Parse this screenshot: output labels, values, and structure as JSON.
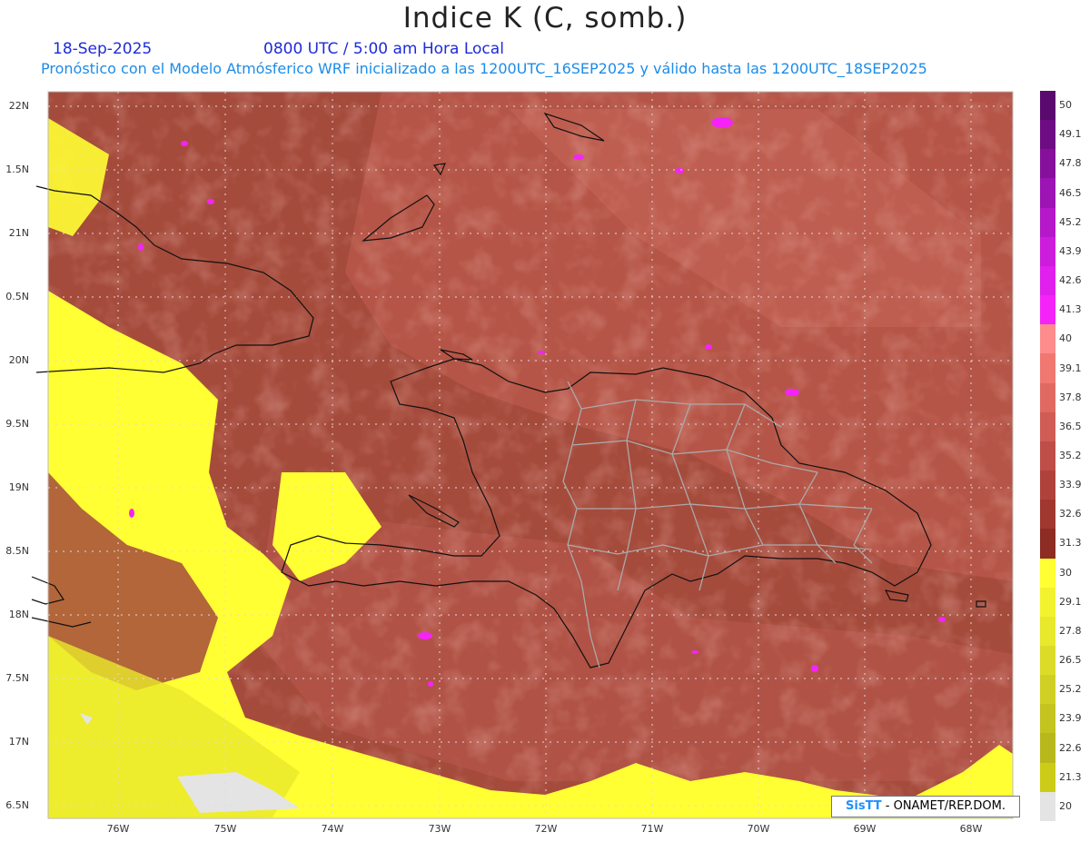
{
  "title": "Indice K (C, somb.)",
  "date": "18-Sep-2025",
  "time": "0800 UTC / 5:00 am Hora Local",
  "description": "Pronóstico con el Modelo Atmósferico WRF inicializado a las 1200UTC_16SEP2025 y válido hasta las  1200UTC_18SEP2025",
  "lat_labels": [
    "22N",
    "1.5N",
    "21N",
    "0.5N",
    "20N",
    "9.5N",
    "19N",
    "8.5N",
    "18N",
    "7.5N",
    "17N",
    "6.5N"
  ],
  "lon_labels": [
    "76W",
    "75W",
    "74W",
    "73W",
    "72W",
    "71W",
    "70W",
    "69W",
    "68W"
  ],
  "colorbar": {
    "labels": [
      "50",
      "49.1",
      "47.8",
      "46.5",
      "45.2",
      "43.9",
      "42.6",
      "41.3",
      "40",
      "39.1",
      "37.8",
      "36.5",
      "35.2",
      "33.9",
      "32.6",
      "31.3",
      "30",
      "29.1",
      "27.8",
      "26.5",
      "25.2",
      "23.9",
      "22.6",
      "21.3",
      "20"
    ],
    "colors": [
      "#5a0a6e",
      "#6e0c84",
      "#86109c",
      "#9c14b4",
      "#b418c8",
      "#cc1cdc",
      "#e020ec",
      "#f424f8",
      "#ff8c8c",
      "#f07870",
      "#e06a62",
      "#d05c56",
      "#c04e48",
      "#b0423c",
      "#a03830",
      "#8c2c22",
      "#ffff33",
      "#f2f22e",
      "#e8e82c",
      "#dcdc28",
      "#d0d024",
      "#c4c420",
      "#b8b81c",
      "#cccc18",
      "#e4e4e4"
    ]
  },
  "credit": {
    "brand": "SisTT",
    "text": " - ONAMET/REP.DOM."
  }
}
